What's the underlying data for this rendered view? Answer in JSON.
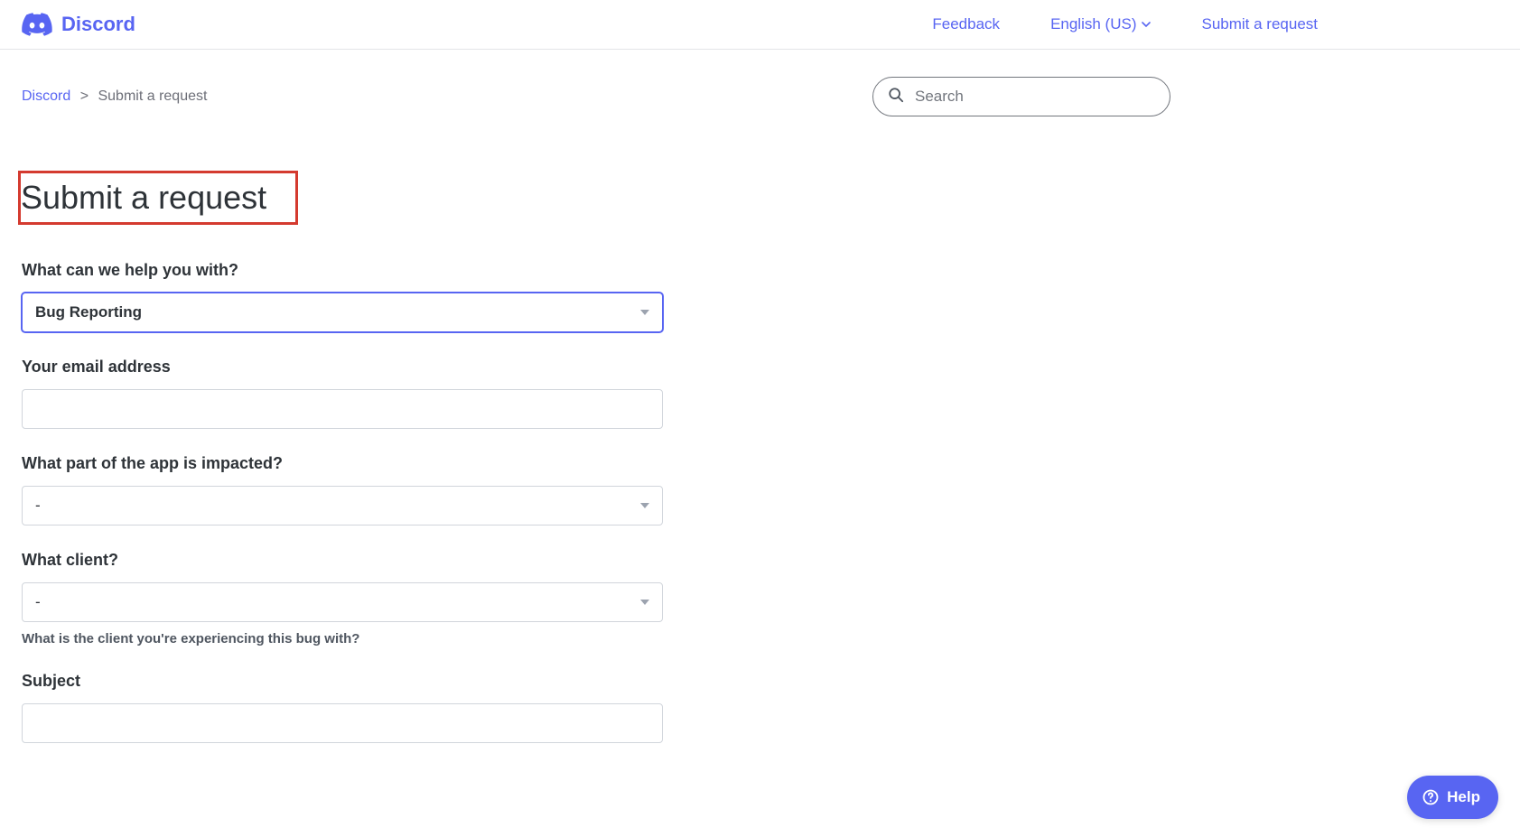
{
  "header": {
    "brand": "Discord",
    "feedback": "Feedback",
    "language": "English (US)",
    "submit": "Submit a request"
  },
  "breadcrumb": {
    "root": "Discord",
    "current": "Submit a request"
  },
  "search": {
    "placeholder": "Search"
  },
  "page": {
    "title": "Submit a request"
  },
  "form": {
    "help_with": {
      "label": "What can we help you with?",
      "value": "Bug Reporting"
    },
    "email": {
      "label": "Your email address",
      "value": ""
    },
    "app_part": {
      "label": "What part of the app is impacted?",
      "value": "-"
    },
    "client": {
      "label": "What client?",
      "value": "-",
      "helper": "What is the client you're experiencing this bug with?"
    },
    "subject": {
      "label": "Subject",
      "value": ""
    }
  },
  "help_widget": {
    "label": "Help"
  }
}
